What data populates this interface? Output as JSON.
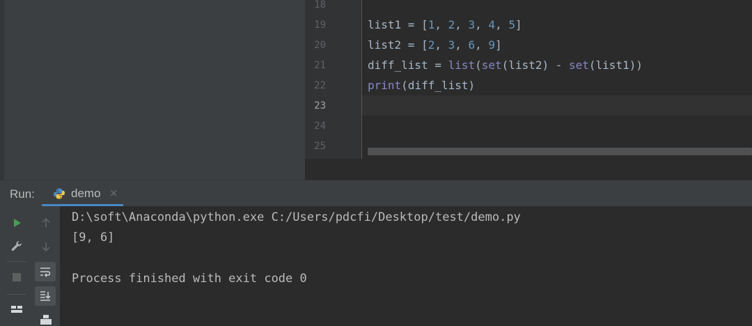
{
  "editor": {
    "line_numbers": [
      "18",
      "19",
      "20",
      "21",
      "22",
      "23",
      "24",
      "25"
    ],
    "current_line": "23",
    "code": {
      "line19": {
        "a": "list1 = [",
        "n1": "1",
        "c1": ", ",
        "n2": "2",
        "c2": ", ",
        "n3": "3",
        "c3": ", ",
        "n4": "4",
        "c4": ", ",
        "n5": "5",
        "z": "]"
      },
      "line20": {
        "a": "list2 = [",
        "n1": "2",
        "c1": ", ",
        "n2": "3",
        "c2": ", ",
        "n3": "6",
        "c3": ", ",
        "n4": "9",
        "z": "]"
      },
      "line21": {
        "a": "diff_list = ",
        "f1": "list",
        "b": "(",
        "f2": "set",
        "c": "(list2) - ",
        "f3": "set",
        "d": "(list1))"
      },
      "line22": {
        "f1": "print",
        "a": "(diff_list)"
      }
    }
  },
  "run_panel": {
    "label": "Run:",
    "tab": {
      "name": "demo",
      "close": "×",
      "icon": "python-icon"
    }
  },
  "toolbar": {
    "icons": [
      "run-icon",
      "up-arrow-icon",
      "wrench-icon",
      "down-arrow-icon",
      "stop-icon",
      "soft-wrap-icon",
      "layout-icon",
      "scroll-to-end-icon",
      "print-icon"
    ]
  },
  "console": {
    "command": "D:\\soft\\Anaconda\\python.exe C:/Users/pdcfi/Desktop/test/demo.py",
    "output": "[9, 6]",
    "exit_message": "Process finished with exit code 0"
  },
  "colors": {
    "background": "#2b2b2b",
    "panel": "#3c3f41",
    "number": "#6897bb",
    "builtin": "#8888c6",
    "text": "#a9b7c6",
    "run_green": "#499c54",
    "tab_accent": "#4a88c7"
  }
}
